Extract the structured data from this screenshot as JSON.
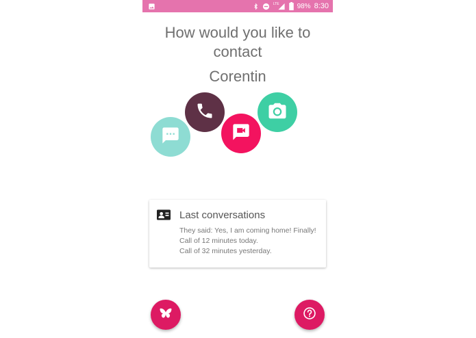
{
  "status_bar": {
    "battery": "98%",
    "time": "8:30",
    "network": "LTE",
    "icons": [
      "image-icon",
      "bluetooth-icon",
      "do-not-disturb-icon",
      "signal-icon",
      "battery-icon"
    ]
  },
  "headline": {
    "line1": "How would you like to",
    "line2": "contact"
  },
  "contact_name": "Corentin",
  "contact_options": [
    {
      "icon": "message-icon",
      "color": "#8edcd3"
    },
    {
      "icon": "phone-icon",
      "color": "#5e3146"
    },
    {
      "icon": "video-message-icon",
      "color": "#f3135f"
    },
    {
      "icon": "camera-icon",
      "color": "#3ecfa4"
    }
  ],
  "last_conversations": {
    "icon": "contact-card-icon",
    "title": "Last conversations",
    "items": [
      "They said: Yes, I am coming home! Finally!",
      "Call of 12 minutes today.",
      "Call of 32 minutes yesterday."
    ]
  },
  "fabs": {
    "left_icon": "butterfly-icon",
    "right_icon": "help-icon",
    "color": "#dd1a63"
  },
  "colors": {
    "status_bar": "#e573ad",
    "text": "#6f6f6f"
  }
}
